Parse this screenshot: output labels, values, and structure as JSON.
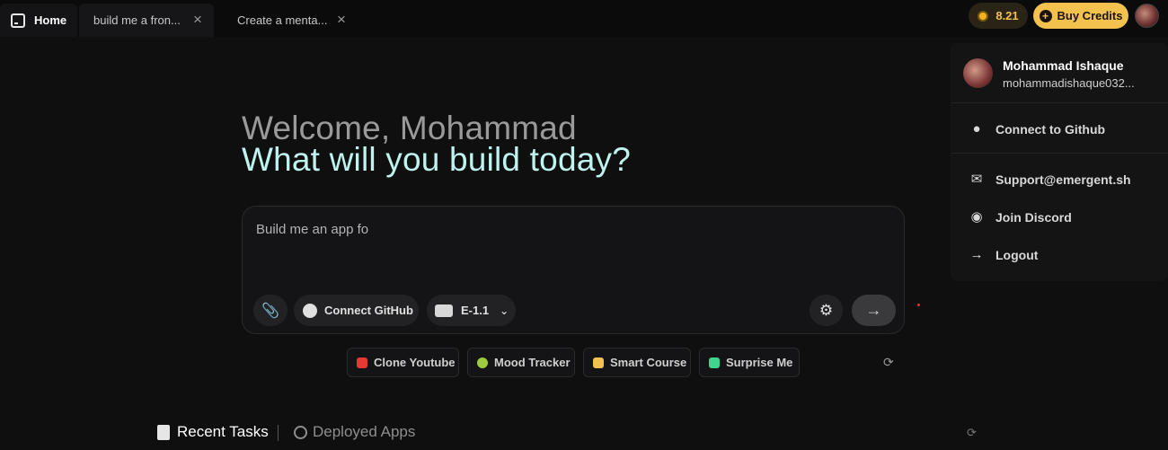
{
  "tabs": {
    "home": "Home",
    "tab1": "build me a fron...",
    "tab2": "Create a menta..."
  },
  "header": {
    "credits": "8.21",
    "buy_credits": "Buy Credits"
  },
  "user_menu": {
    "name": "Mohammad Ishaque",
    "email": "mohammadishaque032...",
    "connect_github": "Connect to Github",
    "support": "Support@emergent.sh",
    "discord": "Join Discord",
    "logout": "Logout"
  },
  "hero": {
    "welcome": "Welcome, Mohammad",
    "question": "What will you build today?"
  },
  "prompt": {
    "text": "Build me an app fo",
    "connect_github": "Connect GitHub",
    "model": "E-1.1"
  },
  "suggestions": [
    {
      "label": "Clone Youtube",
      "color": "#e53935"
    },
    {
      "label": "Mood Tracker",
      "color": "#9ccc3c"
    },
    {
      "label": "Smart Course",
      "color": "#f2c14e"
    },
    {
      "label": "Surprise Me",
      "color": "#3dd68c"
    }
  ],
  "bottom_tabs": {
    "recent": "Recent Tasks",
    "deployed": "Deployed Apps"
  }
}
